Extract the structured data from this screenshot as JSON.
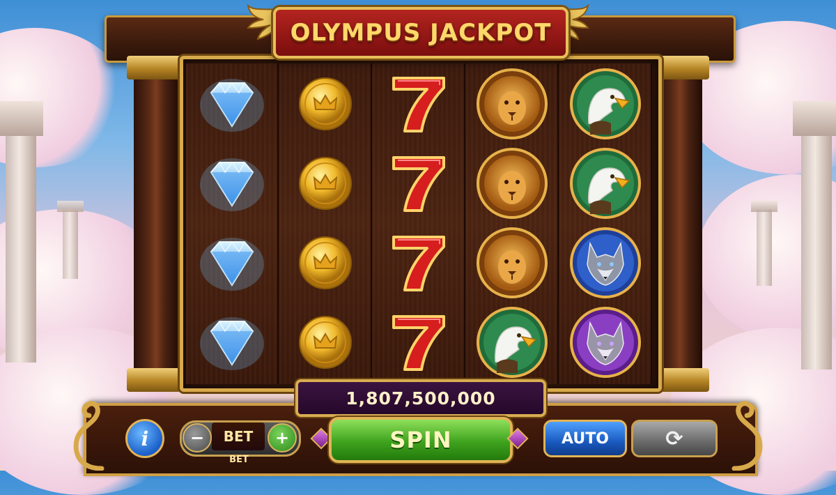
{
  "game": {
    "title": "OLYMPUS JACKPOT",
    "jackpot_amount": "1,807,500,000"
  },
  "reels": [
    [
      "diamond",
      "diamond",
      "diamond",
      "diamond"
    ],
    [
      "gold-coin",
      "gold-coin",
      "gold-coin",
      "gold-coin"
    ],
    [
      "red-seven",
      "red-seven",
      "red-seven",
      "red-seven"
    ],
    [
      "lion",
      "lion",
      "lion",
      "eagle"
    ],
    [
      "eagle",
      "eagle",
      "wolf-blue",
      "wolf-purple"
    ]
  ],
  "controls": {
    "info_label": "i",
    "bet_minus_label": "−",
    "bet_label": "BET",
    "bet_plus_label": "+",
    "bet_caption": "BET",
    "spin_label": "SPIN",
    "auto_label": "AUTO",
    "refresh_label": "⟳"
  },
  "colors": {
    "gold_trim": "#d7a94a",
    "spin_green": "#3fa31e",
    "auto_blue": "#1a5ac0",
    "title_red": "#b3241f"
  }
}
